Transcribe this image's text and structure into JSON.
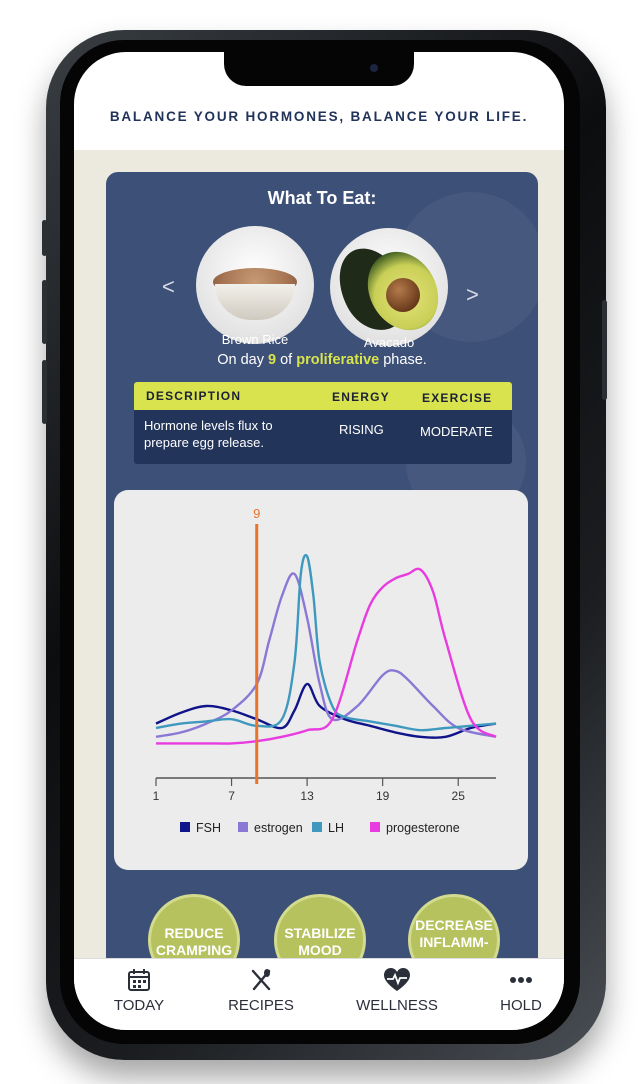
{
  "tagline": "BALANCE YOUR HORMONES, BALANCE YOUR LIFE.",
  "what_to_eat": {
    "title": "What To Eat:",
    "prev_arrow": "<",
    "next_arrow": ">",
    "foods": [
      {
        "label": "Brown Rice",
        "icon": "rice-bowl-image"
      },
      {
        "label": "Avacado",
        "icon": "avocado-image"
      }
    ]
  },
  "phase_line": {
    "prefix": "On day ",
    "day": "9",
    "middle": " of ",
    "phase": "proliferative",
    "suffix": " phase."
  },
  "info_table": {
    "headers": {
      "description": "DESCRIPTION",
      "energy": "ENERGY",
      "exercise": "EXERCISE"
    },
    "row": {
      "description": "Hormone levels flux to prepare egg release.",
      "energy": "RISING",
      "exercise": "MODERATE"
    }
  },
  "chart_data": {
    "type": "line",
    "xlim": [
      1,
      28
    ],
    "ylim": [
      0,
      100
    ],
    "x_ticks": [
      "1",
      "7",
      "13",
      "19",
      "25"
    ],
    "marker": {
      "day": 9,
      "label": "9",
      "color": "#e8732b"
    },
    "series": [
      {
        "name": "FSH",
        "color": "#10148a",
        "x": [
          1,
          3,
          5,
          7,
          9,
          11,
          12,
          13,
          14,
          16,
          18,
          20,
          22,
          24,
          26,
          28
        ],
        "y": [
          12,
          17,
          20,
          18,
          14,
          10,
          18,
          30,
          20,
          14,
          11,
          8,
          6,
          6,
          10,
          12
        ]
      },
      {
        "name": "estrogen",
        "color": "#8a78d4",
        "x": [
          1,
          3,
          5,
          7,
          9,
          10,
          11,
          12,
          13,
          14,
          15,
          17,
          19,
          20,
          21,
          23,
          25,
          28
        ],
        "y": [
          6,
          8,
          12,
          18,
          30,
          50,
          70,
          80,
          60,
          30,
          14,
          20,
          34,
          36,
          32,
          20,
          10,
          6
        ]
      },
      {
        "name": "LH",
        "color": "#3f98be",
        "x": [
          1,
          3,
          5,
          7,
          9,
          11,
          12,
          12.5,
          13,
          13.5,
          14,
          15,
          16,
          18,
          20,
          22,
          24,
          26,
          28
        ],
        "y": [
          10,
          12,
          13,
          14,
          11,
          14,
          40,
          80,
          88,
          70,
          40,
          20,
          15,
          13,
          11,
          9,
          10,
          11,
          12
        ]
      },
      {
        "name": "progesterone",
        "color": "#e83be0",
        "x": [
          1,
          3,
          5,
          7,
          9,
          11,
          13,
          15,
          17,
          18,
          19,
          20,
          21,
          22,
          23,
          24,
          26,
          28
        ],
        "y": [
          3,
          3,
          3,
          3,
          4,
          6,
          9,
          14,
          50,
          66,
          74,
          78,
          80,
          82,
          72,
          50,
          14,
          6
        ]
      }
    ]
  },
  "benefits": [
    "REDUCE CRAMPING",
    "STABILIZE MOOD",
    "DECREASE INFLAMM-"
  ],
  "tabs": [
    {
      "label": "TODAY",
      "icon": "calendar-icon"
    },
    {
      "label": "RECIPES",
      "icon": "utensils-icon"
    },
    {
      "label": "WELLNESS",
      "icon": "heart-pulse-icon"
    },
    {
      "label": "HOLD",
      "icon": "more-dots-icon"
    }
  ],
  "colors": {
    "navy_panel": "#3d5077",
    "accent_yellow": "#d8e34e",
    "pill_green": "#b6c25d"
  }
}
